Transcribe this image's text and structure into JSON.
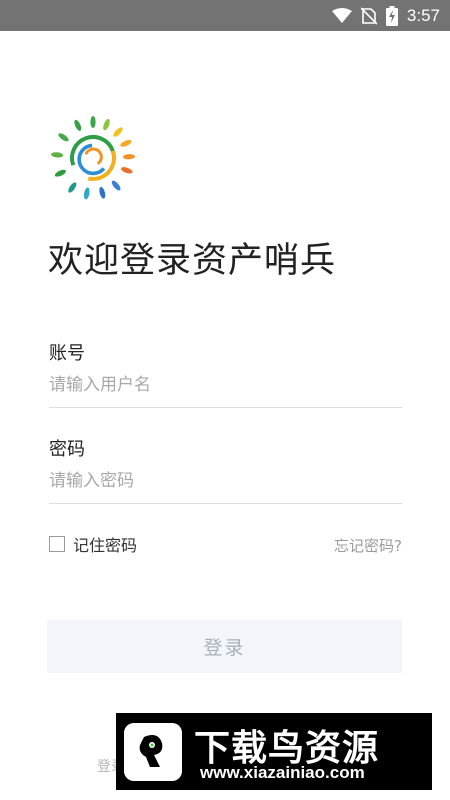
{
  "status_bar": {
    "time": "3:57",
    "icons": [
      "wifi-icon",
      "no-sim-icon",
      "battery-charging-icon"
    ]
  },
  "logo": {
    "icon": "sun-logo-icon"
  },
  "welcome_title": "欢迎登录资产哨兵",
  "account": {
    "label": "账号",
    "placeholder": "请输入用户名",
    "value": ""
  },
  "password": {
    "label": "密码",
    "placeholder": "请输入密码",
    "value": ""
  },
  "remember": {
    "label": "记住密码",
    "checked": false
  },
  "forgot_password": "忘记密码?",
  "login_button": "登录",
  "footer_fragment": "登录",
  "watermark": {
    "title": "下载鸟资源",
    "url": "www.xiazainiao.com"
  },
  "colors": {
    "status_bar": "#737373",
    "button_bg": "#f2f5f9",
    "button_text": "#a8b0bb",
    "placeholder": "#a8a8a8"
  }
}
